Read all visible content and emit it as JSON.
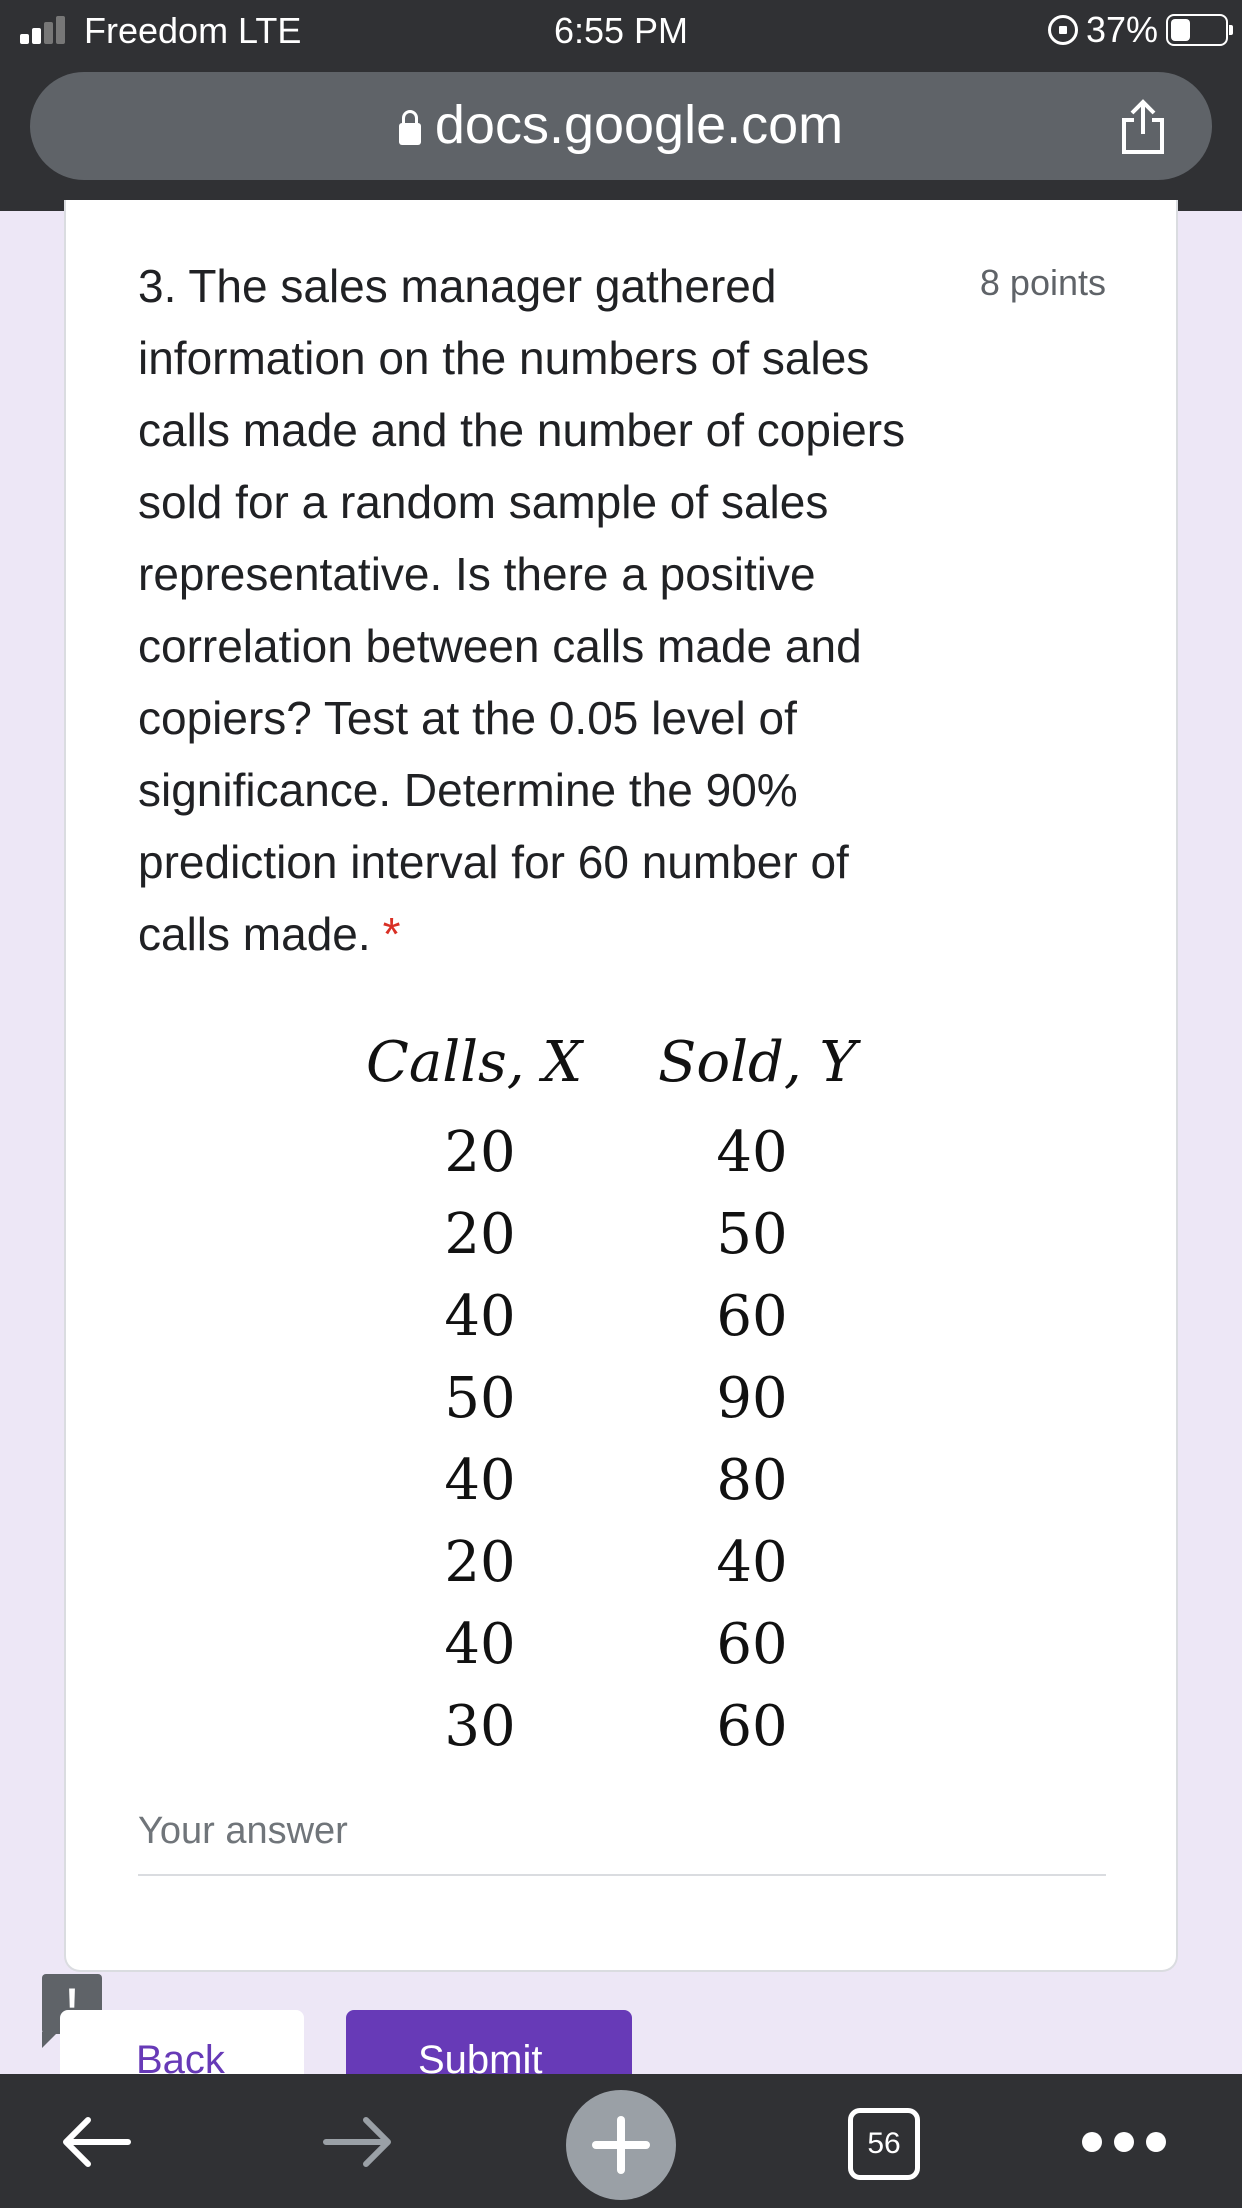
{
  "status_bar": {
    "carrier": "Freedom  LTE",
    "time": "6:55 PM",
    "battery": "37%",
    "battery_level": 0.37
  },
  "browser": {
    "url": "docs.google.com"
  },
  "question": {
    "text": "3. The sales manager gathered information on the numbers of sales calls made and the number of copiers sold for a random sample of sales representative. Is there a positive correlation between calls made and copiers? Test at the 0.05 level of significance. Determine the 90% prediction interval for 60 number of calls made.",
    "required_mark": "*",
    "points": "8 points"
  },
  "data_table": {
    "headers": [
      "Calls, X",
      "Sold, Y"
    ],
    "rows": [
      [
        "20",
        "40"
      ],
      [
        "20",
        "50"
      ],
      [
        "40",
        "60"
      ],
      [
        "50",
        "90"
      ],
      [
        "40",
        "80"
      ],
      [
        "20",
        "40"
      ],
      [
        "40",
        "60"
      ],
      [
        "30",
        "60"
      ]
    ]
  },
  "answer": {
    "placeholder": "Your answer"
  },
  "report_icon": "!",
  "buttons": {
    "back": "Back",
    "submit": "Submit"
  },
  "bottom_toolbar": {
    "tab_count": "56"
  },
  "icons": [
    "signal-icon",
    "rotation-lock-icon",
    "battery-icon",
    "padlock-icon",
    "share-icon",
    "back-arrow-icon",
    "forward-arrow-icon",
    "plus-icon",
    "tabs-icon",
    "more-icon"
  ],
  "colors": {
    "toolbar": "#303134",
    "url_pill": "#5f6368",
    "accent": "#673ab7",
    "background": "#ede7f6",
    "required": "#d93025"
  }
}
